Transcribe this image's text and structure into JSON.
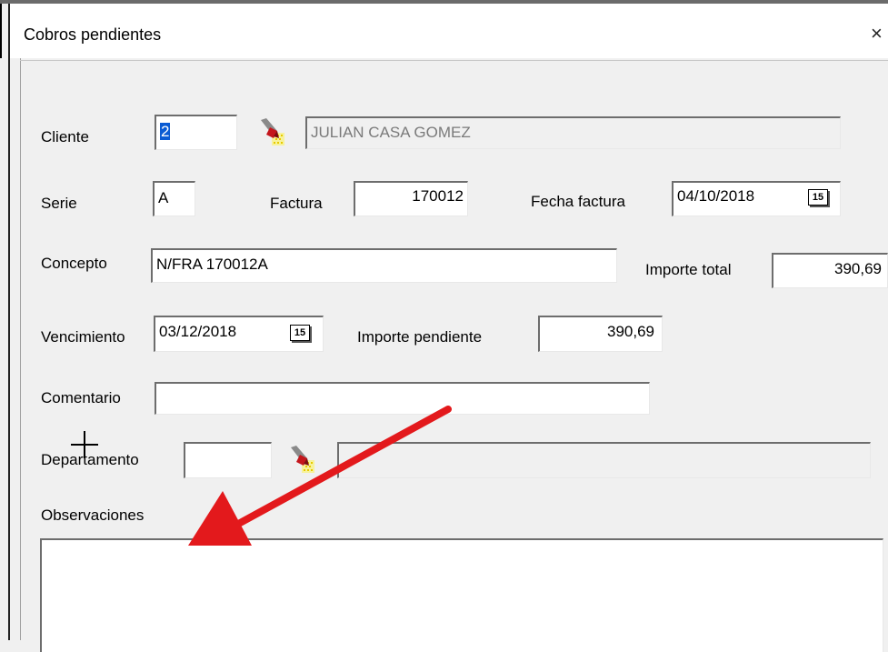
{
  "window": {
    "title": "Cobros pendientes",
    "close_glyph": "×"
  },
  "fields": {
    "cliente": {
      "label": "Cliente",
      "code": "2",
      "name": "JULIAN CASA GOMEZ"
    },
    "serie": {
      "label": "Serie",
      "value": "A"
    },
    "factura": {
      "label": "Factura",
      "value": "170012"
    },
    "fecha_factura": {
      "label": "Fecha factura",
      "value": "04/10/2018"
    },
    "concepto": {
      "label": "Concepto",
      "value": "N/FRA 170012A"
    },
    "importe_total": {
      "label": "Importe total",
      "value": "390,69"
    },
    "vencimiento": {
      "label": "Vencimiento",
      "value": "03/12/2018"
    },
    "importe_pendiente": {
      "label": "Importe pendiente",
      "value": "390,69"
    },
    "comentario": {
      "label": "Comentario",
      "value": ""
    },
    "departamento": {
      "label": "Departamento",
      "code": "",
      "name": ""
    },
    "observaciones": {
      "label": "Observaciones",
      "value": ""
    }
  },
  "calendar_button_text": "15",
  "icons": {
    "lookup": "flashlight-lookup-icon",
    "calendar": "calendar-icon",
    "annotation": "red-arrow",
    "cursor": "crosshair-cursor"
  },
  "colors": {
    "selection": "#0a5bd3",
    "arrow": "#e3191c"
  }
}
